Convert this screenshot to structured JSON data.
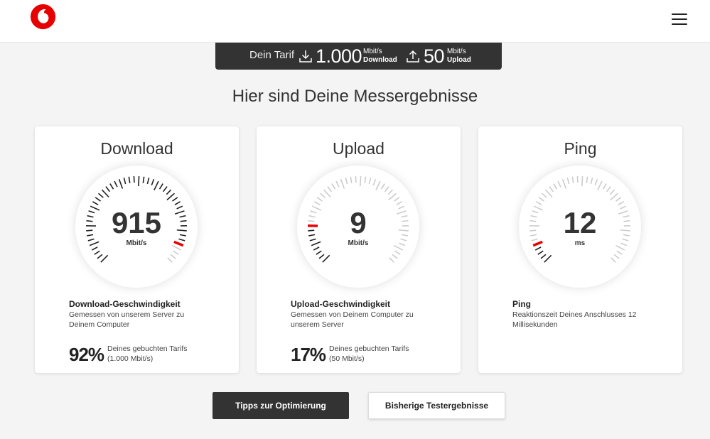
{
  "header": {
    "logo_icon": "vodafone-logo-icon",
    "menu_icon": "hamburger-menu-icon"
  },
  "tariff": {
    "label": "Dein Tarif",
    "download_value": "1.000",
    "download_unit": "Mbit/s",
    "download_label": "Download",
    "upload_value": "50",
    "upload_unit": "Mbit/s",
    "upload_label": "Upload"
  },
  "headline": "Hier sind Deine Messergebnisse",
  "cards": [
    {
      "title": "Download",
      "value": "915",
      "unit": "Mbit/s",
      "gauge_fraction": 0.915,
      "label": "Download-Geschwindigkeit",
      "desc": "Gemessen von unserem Server zu Deinem Computer",
      "percent": "92%",
      "percent_note_1": "Deines gebuchten Tarifs",
      "percent_note_2": "(1.000 Mbit/s)"
    },
    {
      "title": "Upload",
      "value": "9",
      "unit": "Mbit/s",
      "gauge_fraction": 0.17,
      "label": "Upload-Geschwindigkeit",
      "desc": "Gemessen von Deinem Computer zu unserem Server",
      "percent": "17%",
      "percent_note_1": "Deines gebuchten Tarifs",
      "percent_note_2": "(50 Mbit/s)"
    },
    {
      "title": "Ping",
      "value": "12",
      "unit": "ms",
      "gauge_fraction": 0.08,
      "label": "Ping",
      "desc": "Reaktionszeit Deines Anschlusses 12 Millisekunden"
    }
  ],
  "buttons": {
    "tips": "Tipps zur Optimierung",
    "history": "Bisherige Testergebnisse"
  },
  "colors": {
    "accent": "#e60000",
    "dark": "#333333",
    "tick_active": "#222222",
    "tick_inactive": "#cccccc"
  }
}
